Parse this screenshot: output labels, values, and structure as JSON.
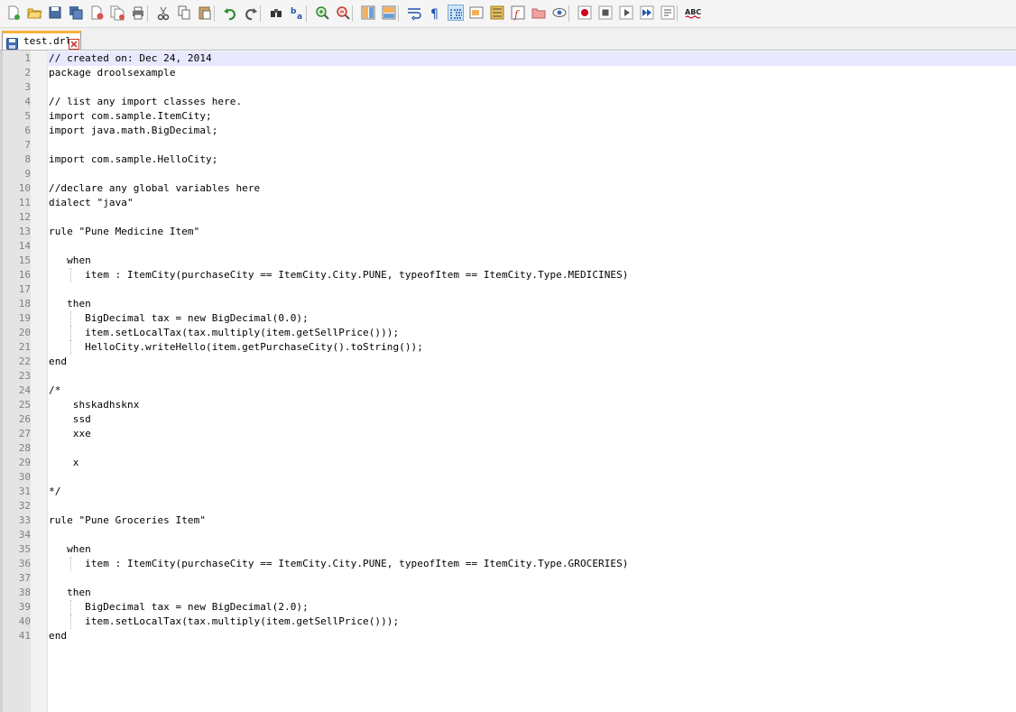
{
  "toolbar": {
    "buttons": [
      {
        "icon": "new-file-icon",
        "group": 1
      },
      {
        "icon": "open-file-icon",
        "group": 1
      },
      {
        "icon": "save-icon",
        "group": 1
      },
      {
        "icon": "save-all-icon",
        "group": 1
      },
      {
        "icon": "close-icon",
        "group": 1
      },
      {
        "icon": "close-all-icon",
        "group": 1
      },
      {
        "icon": "print-icon",
        "group": 1
      },
      {
        "icon": "cut-icon",
        "group": 2
      },
      {
        "icon": "copy-icon",
        "group": 2
      },
      {
        "icon": "paste-icon",
        "group": 2
      },
      {
        "icon": "undo-icon",
        "group": 3
      },
      {
        "icon": "redo-icon",
        "group": 3
      },
      {
        "icon": "find-icon",
        "group": 4
      },
      {
        "icon": "replace-icon",
        "group": 4
      },
      {
        "icon": "zoom-in-icon",
        "group": 5
      },
      {
        "icon": "zoom-out-icon",
        "group": 5
      },
      {
        "icon": "sync-vertical-icon",
        "group": 6
      },
      {
        "icon": "sync-horizontal-icon",
        "group": 6
      },
      {
        "icon": "word-wrap-icon",
        "group": 7
      },
      {
        "icon": "show-all-characters-icon",
        "group": 7
      },
      {
        "icon": "indent-guide-icon",
        "group": 7,
        "active": true
      },
      {
        "icon": "user-defined-language-icon",
        "group": 7
      },
      {
        "icon": "document-map-icon",
        "group": 7
      },
      {
        "icon": "function-list-icon",
        "group": 7
      },
      {
        "icon": "folder-as-workspace-icon",
        "group": 7
      },
      {
        "icon": "monitoring-icon",
        "group": 7
      },
      {
        "icon": "record-macro-icon",
        "group": 8
      },
      {
        "icon": "stop-recording-icon",
        "group": 8
      },
      {
        "icon": "playback-macro-icon",
        "group": 8
      },
      {
        "icon": "run-macro-multiple-icon",
        "group": 8
      },
      {
        "icon": "save-macro-icon",
        "group": 8
      },
      {
        "icon": "spell-check-icon",
        "group": 9,
        "label": "ABC"
      }
    ]
  },
  "tab": {
    "label": "test.drl",
    "icon": "save-icon",
    "close_icon": "close-icon"
  },
  "editor": {
    "current_line": 1,
    "lines": [
      {
        "n": "1",
        "text": "// created on: Dec 24, 2014"
      },
      {
        "n": "2",
        "text": "package droolsexample"
      },
      {
        "n": "3",
        "text": ""
      },
      {
        "n": "4",
        "text": "// list any import classes here."
      },
      {
        "n": "5",
        "text": "import com.sample.ItemCity;"
      },
      {
        "n": "6",
        "text": "import java.math.BigDecimal;"
      },
      {
        "n": "7",
        "text": ""
      },
      {
        "n": "8",
        "text": "import com.sample.HelloCity;"
      },
      {
        "n": "9",
        "text": ""
      },
      {
        "n": "10",
        "text": "//declare any global variables here"
      },
      {
        "n": "11",
        "text": "dialect \"java\""
      },
      {
        "n": "12",
        "text": ""
      },
      {
        "n": "13",
        "text": "rule \"Pune Medicine Item\""
      },
      {
        "n": "14",
        "text": ""
      },
      {
        "n": "15",
        "text": "   when"
      },
      {
        "n": "16",
        "text": "      item : ItemCity(purchaseCity == ItemCity.City.PUNE, typeofItem == ItemCity.Type.MEDICINES)"
      },
      {
        "n": "17",
        "text": ""
      },
      {
        "n": "18",
        "text": "   then"
      },
      {
        "n": "19",
        "text": "      BigDecimal tax = new BigDecimal(0.0);"
      },
      {
        "n": "20",
        "text": "      item.setLocalTax(tax.multiply(item.getSellPrice()));"
      },
      {
        "n": "21",
        "text": "      HelloCity.writeHello(item.getPurchaseCity().toString());"
      },
      {
        "n": "22",
        "text": "end"
      },
      {
        "n": "23",
        "text": ""
      },
      {
        "n": "24",
        "text": "/*"
      },
      {
        "n": "25",
        "text": "    shskadhsknx"
      },
      {
        "n": "26",
        "text": "    ssd"
      },
      {
        "n": "27",
        "text": "    xxe"
      },
      {
        "n": "28",
        "text": ""
      },
      {
        "n": "29",
        "text": "    x"
      },
      {
        "n": "30",
        "text": ""
      },
      {
        "n": "31",
        "text": "*/"
      },
      {
        "n": "32",
        "text": ""
      },
      {
        "n": "33",
        "text": "rule \"Pune Groceries Item\""
      },
      {
        "n": "34",
        "text": ""
      },
      {
        "n": "35",
        "text": "   when"
      },
      {
        "n": "36",
        "text": "      item : ItemCity(purchaseCity == ItemCity.City.PUNE, typeofItem == ItemCity.Type.GROCERIES)"
      },
      {
        "n": "37",
        "text": ""
      },
      {
        "n": "38",
        "text": "   then"
      },
      {
        "n": "39",
        "text": "      BigDecimal tax = new BigDecimal(2.0);"
      },
      {
        "n": "40",
        "text": "      item.setLocalTax(tax.multiply(item.getSellPrice()));"
      },
      {
        "n": "41",
        "text": "end"
      }
    ]
  },
  "colors": {
    "current_line_bg": "#e8e8ff",
    "tab_accent": "#f7b23b",
    "line_number": "#808080",
    "gutter_bg": "#e4e4e4"
  }
}
